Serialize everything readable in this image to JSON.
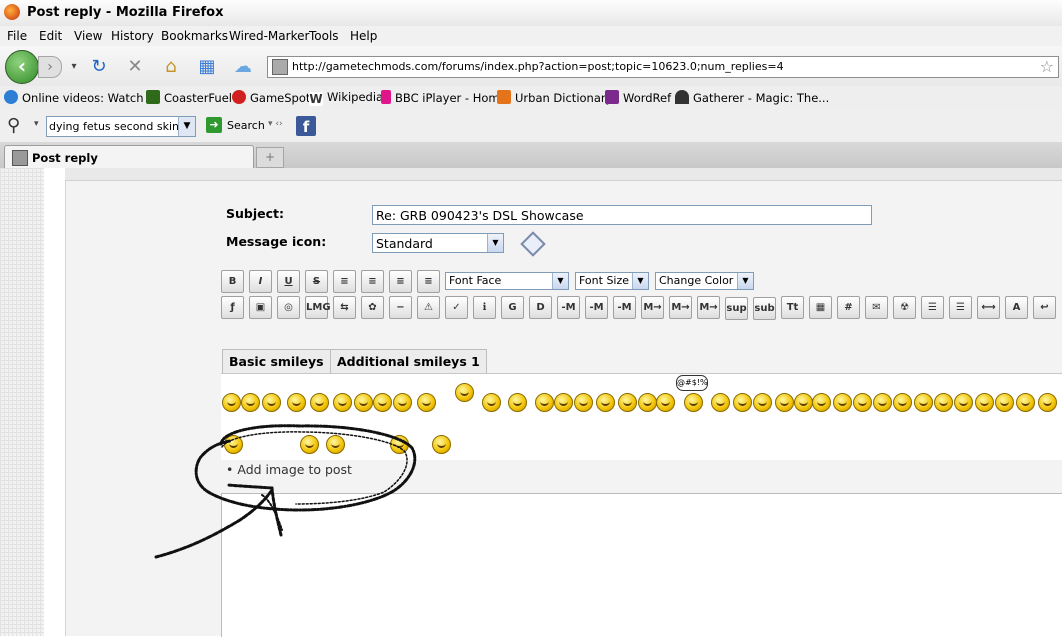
{
  "window": {
    "title": "Post reply - Mozilla Firefox"
  },
  "menu": [
    "File",
    "Edit",
    "View",
    "History",
    "Bookmarks",
    "Wired-Marker",
    "Tools",
    "Help"
  ],
  "nav": {
    "url": "http://gametechmods.com/forums/index.php?action=post;topic=10623.0;num_replies=4"
  },
  "bookmarks": [
    {
      "label": "Online videos: Watch ...",
      "color": "#2d7fd6"
    },
    {
      "label": "CoasterFuel",
      "color": "#2f6a1b"
    },
    {
      "label": "GameSpot",
      "color": "#d02020"
    },
    {
      "label": "Wikipedia",
      "color": "#555555"
    },
    {
      "label": "BBC iPlayer - Home",
      "color": "#e0158b"
    },
    {
      "label": "Urban Dictionary",
      "color": "#e4731a"
    },
    {
      "label": "WordRef",
      "color": "#7b2a8c"
    },
    {
      "label": "Gatherer - Magic: The...",
      "color": "#333333"
    }
  ],
  "searchbar": {
    "query": "dying fetus second skin",
    "search_label": "Search"
  },
  "tab": {
    "label": "Post reply"
  },
  "form": {
    "subject_label": "Subject:",
    "subject_value": "Re: GRB 090423's DSL Showcase",
    "icon_label": "Message icon:",
    "icon_value": "Standard"
  },
  "toolbar": {
    "row1": [
      "B",
      "I",
      "U",
      "S",
      "≡",
      "≡",
      "≡",
      "≡"
    ],
    "font_face": "Font Face",
    "font_size": "Font Size",
    "change_color": "Change Color",
    "row2": [
      "ƒ",
      "▣",
      "◎",
      "LMG",
      "⇆",
      "✿",
      "−",
      "⚠",
      "✓",
      "ℹ",
      "G",
      "D",
      "-M",
      "-M",
      "-M",
      "M→",
      "M→",
      "M→",
      "sup",
      "sub",
      "Tt",
      "▦",
      "#",
      "✉",
      "☢",
      "☰",
      "☰",
      "⟷",
      "А",
      "↩"
    ]
  },
  "smiley_tabs": [
    "Basic smileys",
    "Additional smileys 1"
  ],
  "smiley_caption": "@#$!%",
  "add_image_label": "Add image to post"
}
